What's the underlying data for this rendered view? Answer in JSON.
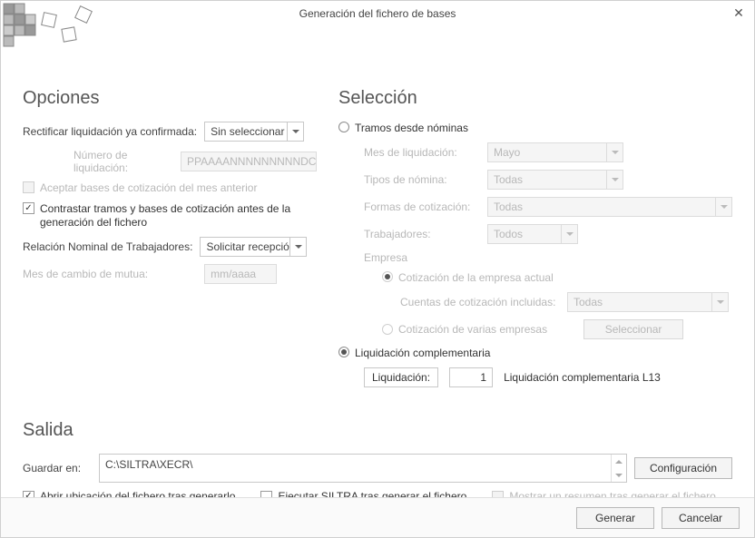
{
  "title": "Generación del fichero de bases",
  "sections": {
    "opciones": "Opciones",
    "seleccion": "Selección",
    "salida": "Salida"
  },
  "opciones": {
    "rectificar_label": "Rectificar liquidación ya confirmada:",
    "rectificar_value": "Sin seleccionar",
    "numero_label": "Número de liquidación:",
    "numero_placeholder": "PPAAAANNNNNNNNNDC",
    "aceptar_bases": "Aceptar bases de cotización del mes anterior",
    "contrastar": "Contrastar tramos y bases de cotización antes de la generación del fichero",
    "rnt_label": "Relación Nominal de Trabajadores:",
    "rnt_value": "Solicitar recepció",
    "mes_mutua_label": "Mes de cambio de mutua:",
    "mes_mutua_placeholder": "mm/aaaa"
  },
  "seleccion": {
    "tramos_label": "Tramos desde nóminas",
    "mes_label": "Mes de liquidación:",
    "mes_value": "Mayo",
    "tipos_label": "Tipos de nómina:",
    "tipos_value": "Todas",
    "formas_label": "Formas de cotización:",
    "formas_value": "Todas",
    "trabajadores_label": "Trabajadores:",
    "trabajadores_value": "Todos",
    "empresa_label": "Empresa",
    "cot_actual": "Cotización de la empresa actual",
    "cuentas_label": "Cuentas de cotización incluidas:",
    "cuentas_value": "Todas",
    "cot_varias": "Cotización de varias empresas",
    "seleccionar_btn": "Seleccionar",
    "liq_comp_label": "Liquidación complementaria",
    "liquidacion_btn": "Liquidación:",
    "liquidacion_num": "1",
    "liquidacion_text": "Liquidación complementaria L13"
  },
  "salida": {
    "guardar_label": "Guardar en:",
    "guardar_value": "C:\\SILTRA\\XECR\\",
    "config_btn": "Configuración",
    "abrir": "Abrir ubicación del fichero tras generarlo",
    "ejecutar": "Ejecutar SILTRA tras generar el fichero",
    "mostrar": "Mostrar un resumen tras generar el fichero"
  },
  "footer": {
    "generar": "Generar",
    "cancelar": "Cancelar"
  }
}
